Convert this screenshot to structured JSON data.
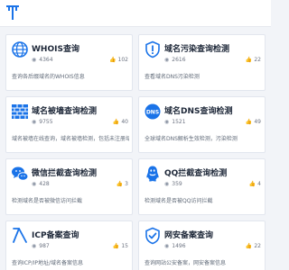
{
  "brand": {
    "logo_icon": "tools-logo-icon",
    "color": "#1a73e8"
  },
  "accent": "#1a73e8",
  "cards": [
    {
      "title": "WHOIS查询",
      "views": "4364",
      "likes": "102",
      "desc": "查询各后缀域名的WHOIS信息",
      "icon": "globe-icon"
    },
    {
      "title": "域名污染查询检测",
      "views": "2616",
      "likes": "22",
      "desc": "查看域名DNS污染检测",
      "icon": "shield-alert-icon"
    },
    {
      "title": "域名被墙查询检测",
      "views": "9755",
      "likes": "40",
      "desc": "域名被墙在线查询，域名被墙检测，包括未注册域名",
      "icon": "brick-wall-icon"
    },
    {
      "title": "域名DNS查询检测",
      "views": "1521",
      "likes": "49",
      "desc": "全球域名DNS解析生效检测，污染检测",
      "icon": "dns-icon"
    },
    {
      "title": "微信拦截查询检测",
      "views": "428",
      "likes": "3",
      "desc": "检测域名是否被微信访问拦截",
      "icon": "wechat-icon"
    },
    {
      "title": "QQ拦截查询检测",
      "views": "359",
      "likes": "4",
      "desc": "检测域名是否被QQ访问拦截",
      "icon": "qq-icon"
    },
    {
      "title": "ICP备案查询",
      "views": "987",
      "likes": "15",
      "desc": "查询ICP/IP地址/域名备案信息",
      "icon": "icp-icon"
    },
    {
      "title": "网安备案查询",
      "views": "1496",
      "likes": "22",
      "desc": "查询网站公安备案，网安备案信息",
      "icon": "shield-check-icon"
    }
  ]
}
